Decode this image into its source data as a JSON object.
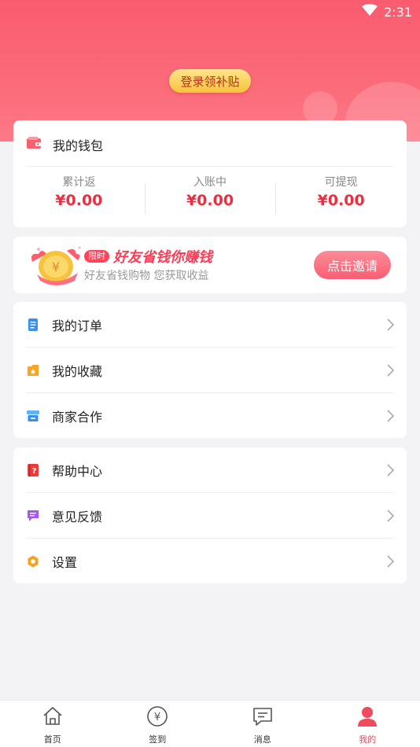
{
  "status_bar": {
    "time": "2:31"
  },
  "header": {
    "login_button": "登录领补贴"
  },
  "wallet": {
    "title": "我的钱包",
    "stats": [
      {
        "label": "累计返",
        "value": "¥0.00"
      },
      {
        "label": "入账中",
        "value": "¥0.00"
      },
      {
        "label": "可提现",
        "value": "¥0.00"
      }
    ]
  },
  "invite": {
    "badge": "限时",
    "title": "好友省钱你赚钱",
    "subtitle": "好友省钱购物 您获取收益",
    "button": "点击邀请"
  },
  "menu_group_1": [
    {
      "label": "我的订单",
      "icon": "order-icon",
      "color": "#3a8ef0"
    },
    {
      "label": "我的收藏",
      "icon": "favorite-icon",
      "color": "#f5a623"
    },
    {
      "label": "商家合作",
      "icon": "store-icon",
      "color": "#3aa3f5"
    }
  ],
  "menu_group_2": [
    {
      "label": "帮助中心",
      "icon": "help-icon",
      "color": "#ef3a3a"
    },
    {
      "label": "意见反馈",
      "icon": "feedback-icon",
      "color": "#a457f0"
    },
    {
      "label": "设置",
      "icon": "settings-icon",
      "color": "#f5a21f"
    }
  ],
  "tabbar": {
    "items": [
      {
        "label": "首页",
        "icon": "home-icon"
      },
      {
        "label": "签到",
        "icon": "checkin-icon"
      },
      {
        "label": "消息",
        "icon": "message-icon"
      },
      {
        "label": "我的",
        "icon": "profile-icon",
        "active": true
      }
    ],
    "active_color": "#f04a5c"
  }
}
